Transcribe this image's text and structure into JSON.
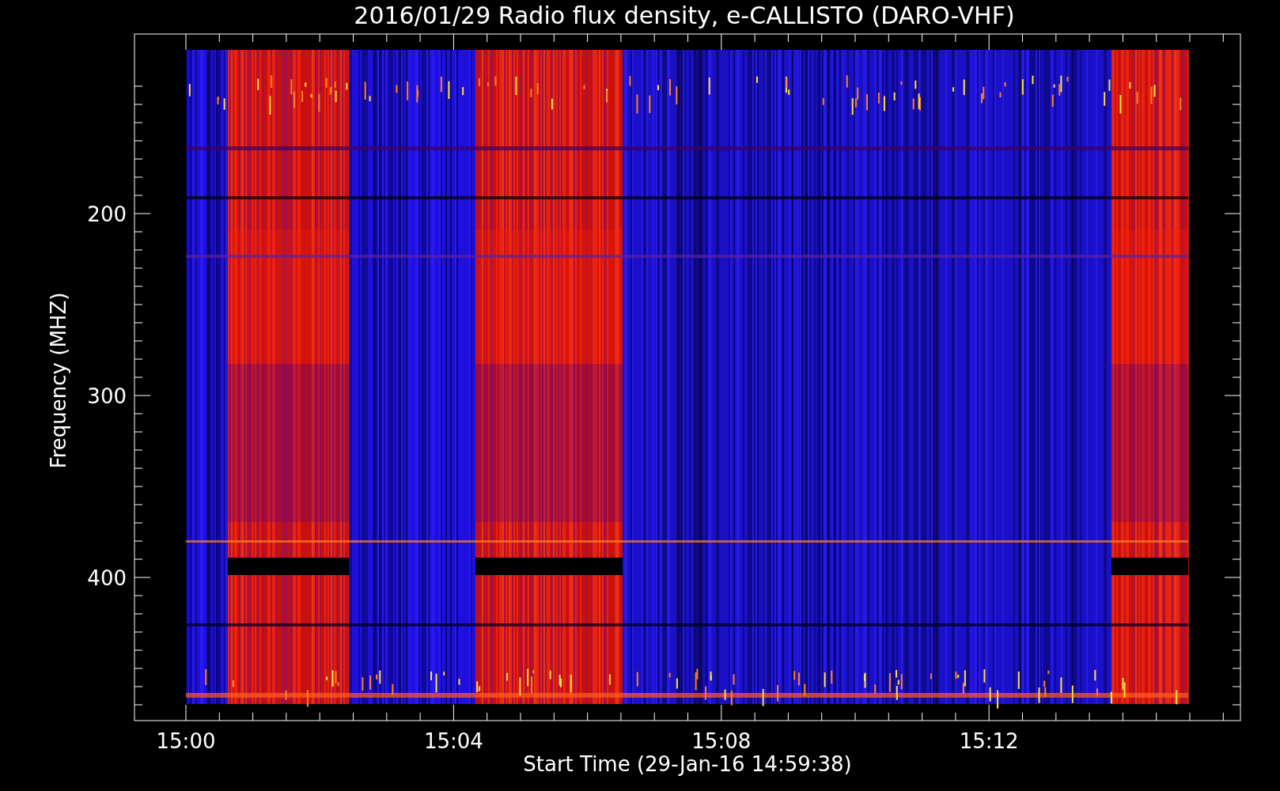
{
  "title": "2016/01/29  Radio flux density, e-CALLISTO (DARO-VHF)",
  "y_axis": {
    "label": "Frequency (MHZ)",
    "tick_labels": [
      "200",
      "300",
      "400"
    ]
  },
  "x_axis": {
    "label": "Start Time (29-Jan-16 14:59:38)",
    "tick_labels": [
      "15:00",
      "15:04",
      "15:08",
      "15:12"
    ]
  }
}
